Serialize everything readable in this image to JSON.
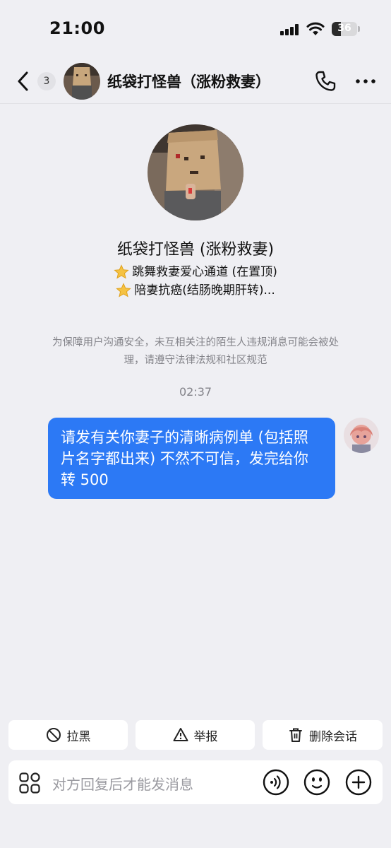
{
  "status_bar": {
    "time": "21:00",
    "battery": "36",
    "battery_level": 0.36
  },
  "nav": {
    "unread_count": "3",
    "title": "纸袋打怪兽（涨粉救妻）",
    "back_icon": "chevron-left-icon",
    "call_icon": "phone-icon",
    "more_icon": "more-dots-icon"
  },
  "profile": {
    "name": "纸袋打怪兽 (涨粉救妻)",
    "bio": [
      {
        "icon": "star-icon",
        "text": "跳舞救妻爱心通道 (在置顶)"
      },
      {
        "icon": "star-icon",
        "text": "陪妻抗癌(结肠晚期肝转)..."
      }
    ]
  },
  "notice": "为保障用户沟通安全，未互相关注的陌生人违规消息可能会被处理，请遵守法律法规和社区规范",
  "messages": [
    {
      "timestamp": "02:37",
      "sender": "self",
      "text": "请发有关你妻子的清晰病例单 (包括照片名字都出来) 不然不可信，发完给你转 500"
    }
  ],
  "actions": [
    {
      "label": "拉黑",
      "icon": "block-icon"
    },
    {
      "label": "举报",
      "icon": "warning-icon"
    },
    {
      "label": "删除会话",
      "icon": "trash-icon"
    }
  ],
  "input": {
    "placeholder": "对方回复后才能发消息",
    "left_icon": "apps-grid-icon",
    "right_icons": [
      "voice-icon",
      "emoji-icon",
      "plus-icon"
    ]
  },
  "colors": {
    "accent": "#2c79f5",
    "background": "#efeff3"
  }
}
